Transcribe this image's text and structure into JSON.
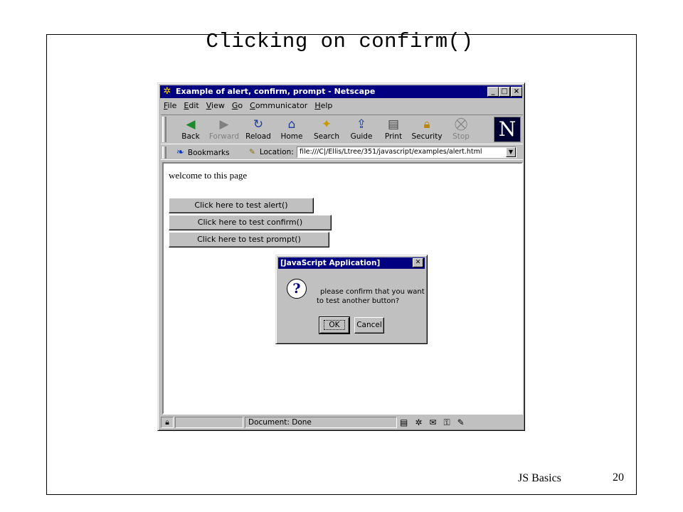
{
  "slide": {
    "title": "Clicking on confirm()",
    "footer_label": "JS Basics",
    "page_number": "20"
  },
  "browser": {
    "window_title": "Example of alert, confirm, prompt - Netscape",
    "menu": [
      {
        "key": "F",
        "rest": "ile"
      },
      {
        "key": "E",
        "rest": "dit"
      },
      {
        "key": "V",
        "rest": "iew"
      },
      {
        "key": "G",
        "rest": "o"
      },
      {
        "key": "C",
        "rest": "ommunicator"
      },
      {
        "key": "H",
        "rest": "elp"
      }
    ],
    "toolbar": {
      "back": "Back",
      "forward": "Forward",
      "reload": "Reload",
      "home": "Home",
      "search": "Search",
      "guide": "Guide",
      "print": "Print",
      "security": "Security",
      "stop": "Stop",
      "logo_letter": "N"
    },
    "location_bar": {
      "bookmarks": "Bookmarks",
      "location_label": "Location:",
      "url": "file:///C|/Ellis/Ltree/351/javascript/examples/alert.html"
    },
    "page": {
      "welcome": "welcome to this page",
      "buttons": [
        "Click here to test alert()",
        "Click here to test confirm()",
        "Click here to test prompt()"
      ]
    },
    "status": {
      "text": "Document: Done"
    }
  },
  "dialog": {
    "title": "[JavaScript Application]",
    "message_line1": "please confirm that you want",
    "message_line2": "to test another button?",
    "ok": "OK",
    "cancel": "Cancel"
  },
  "colors": {
    "titlebar": "#000080",
    "chrome": "#c0c0c0"
  }
}
